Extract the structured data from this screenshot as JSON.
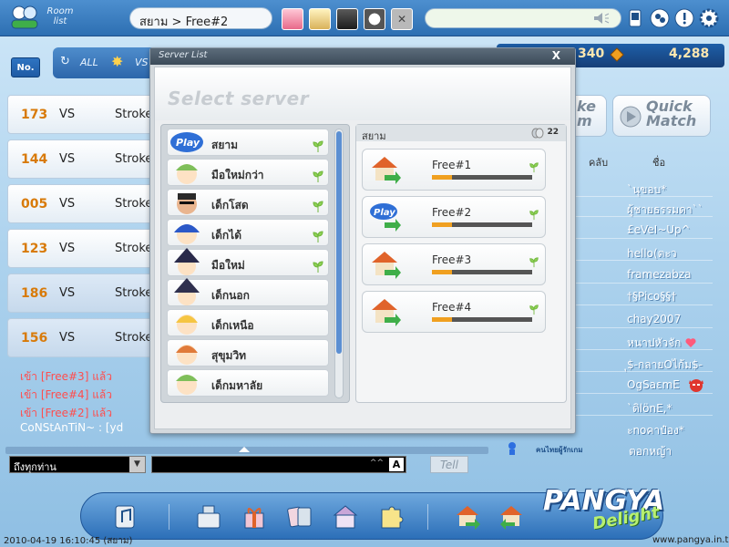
{
  "top_bar": {
    "room_label": "Room list",
    "breadcrumb": "สยาม > Free#2"
  },
  "sub_bar": {
    "no_label": "No.",
    "filter_all": "ALL",
    "filter_vs": "VS",
    "stat_a": "340",
    "stat_b": "4,288"
  },
  "rooms": [
    {
      "no": "173",
      "vs": "VS",
      "mode": "Stroke"
    },
    {
      "no": "144",
      "vs": "VS",
      "mode": "Stroke"
    },
    {
      "no": "005",
      "vs": "VS",
      "mode": "Stroke"
    },
    {
      "no": "123",
      "vs": "VS",
      "mode": "Stroke"
    },
    {
      "no": "186",
      "vs": "VS",
      "mode": "Stroke"
    },
    {
      "no": "156",
      "vs": "VS",
      "mode": "Stroke"
    }
  ],
  "chat": {
    "lines": [
      "เข้า [Free#3] แล้ว",
      "เข้า [Free#4] แล้ว",
      "เข้า [Free#2] แล้ว",
      "CoNStAnTiN~ : [yd"
    ],
    "target": "ถึงทุกท่าน",
    "caret": "^^",
    "lang": "A",
    "tell": "Tell"
  },
  "right_panel": {
    "make_label": "ke m",
    "quick_match": "Quick Match",
    "header_club": "คลับ",
    "header_name": "ชื่อ",
    "members": [
      "`นุขอบ*",
      "ผู้ชายธรรมดา``",
      "£eVeI~Up^",
      "hello(ตะว",
      "framezabza",
      "†§Pico§§†",
      "chay2007",
      "หนาปหัวจัก",
      "ุ$-กลายOไก้ม$-",
      "OgSaεmE",
      "`ดิlönE,*",
      "ะnoคาป๋อง*",
      "ตอกหญ้า"
    ],
    "club_tag": "คนไทยผู้รักเกม"
  },
  "modal": {
    "title": "Server List",
    "close": "X",
    "heading": "Select server",
    "channels": [
      "สยาม",
      "มือใหม่กว่า",
      "เด็กโสด",
      "เด็กได้",
      "มือใหม่",
      "เด็กนอก",
      "เด็กเหนือ",
      "สุขุมวิท",
      "เด็กมหาลัย"
    ],
    "selected_channel": "สยาม",
    "server_count": "22",
    "servers": [
      {
        "name": "Free#1",
        "load": 0.2
      },
      {
        "name": "Free#2",
        "load": 0.2
      },
      {
        "name": "Free#3",
        "load": 0.2
      },
      {
        "name": "Free#4",
        "load": 0.2
      }
    ]
  },
  "footer": {
    "logo": "PANGYA",
    "logo_sub": "Delight",
    "timestamp": "2010-04-19 16:10:45 (สยาม)",
    "url": "www.pangya.in.th"
  },
  "colors": {
    "accent": "#2d6fb2",
    "room_no": "#d87a08",
    "chat_system": "#ff4d4d",
    "load_fill": "#f0a020"
  }
}
